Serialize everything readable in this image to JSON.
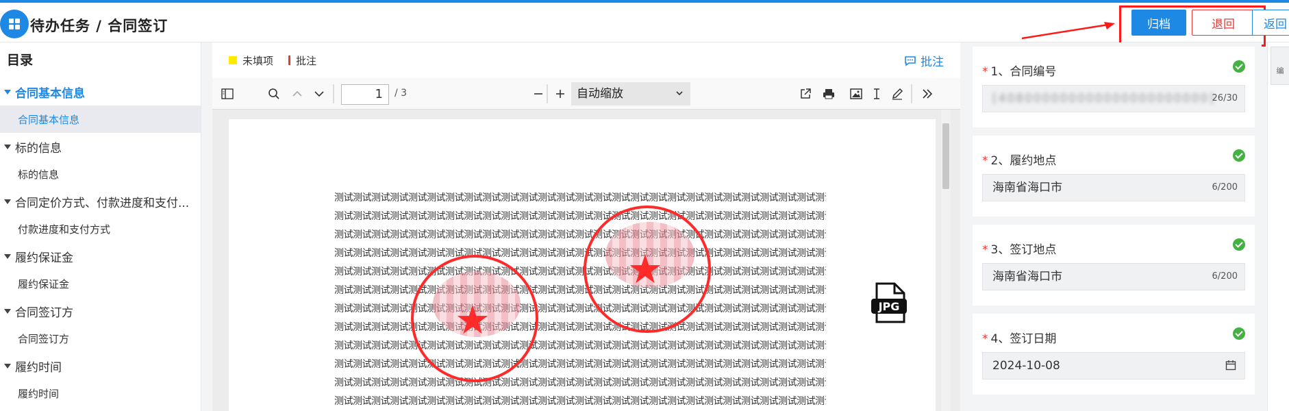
{
  "header": {
    "title": "待办任务 / 合同签订",
    "archive_label": "归档",
    "reject_label": "退回",
    "return_label": "返回"
  },
  "toc": {
    "title": "目录",
    "items": [
      {
        "type": "section",
        "label": "合同基本信息",
        "active": true
      },
      {
        "type": "sub",
        "label": "合同基本信息",
        "active": true
      },
      {
        "type": "section",
        "label": "标的信息"
      },
      {
        "type": "sub",
        "label": "标的信息"
      },
      {
        "type": "section",
        "label": "合同定价方式、付款进度和支付..."
      },
      {
        "type": "sub",
        "label": "付款进度和支付方式"
      },
      {
        "type": "section",
        "label": "履约保证金"
      },
      {
        "type": "sub",
        "label": "履约保证金"
      },
      {
        "type": "section",
        "label": "合同签订方"
      },
      {
        "type": "sub",
        "label": "合同签订方"
      },
      {
        "type": "section",
        "label": "履约时间"
      },
      {
        "type": "sub",
        "label": "履约时间"
      }
    ]
  },
  "viewer": {
    "legend_unfilled": "未填项",
    "legend_annotation": "批注",
    "annotate_button": "批注",
    "page_current": "1",
    "page_total": "/ 3",
    "zoom": "自动缩放",
    "body_line": "测试测试测试测试测试测试测试测试测试测试测试测试测试测试测试测试测试测试测试测试测试测试测试测试测试测试测试测试测试测试测试测试测试测试测试测试测试测试测试"
  },
  "form": {
    "fields": [
      {
        "label": "1、合同编号",
        "value": "[408000000000000000000000]",
        "count": "26/30",
        "blurred": true
      },
      {
        "label": "2、履约地点",
        "value": "海南省海口市",
        "count": "6/200"
      },
      {
        "label": "3、签订地点",
        "value": "海南省海口市",
        "count": "6/200"
      },
      {
        "label": "4、签订日期",
        "value": "2024-10-08",
        "count": ""
      }
    ]
  },
  "side_tab_label": "编",
  "colors": {
    "accent": "#1e88e5",
    "danger": "#e53935",
    "success": "#43b243",
    "highlight_box": "#ff1a1a"
  }
}
